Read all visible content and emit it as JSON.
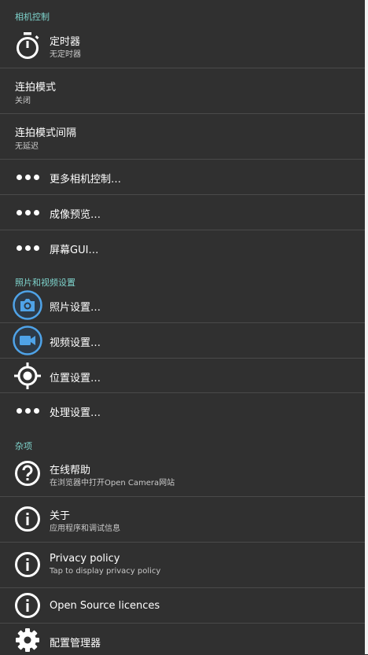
{
  "sections": {
    "camera_controls": "相机控制",
    "photo_video_settings": "照片和视频设置",
    "misc": "杂项"
  },
  "items": {
    "timer": {
      "title": "定时器",
      "summary": "无定时器"
    },
    "burst_mode": {
      "title": "连拍模式",
      "summary": "关闭"
    },
    "burst_interval": {
      "title": "连拍模式间隔",
      "summary": "无延迟"
    },
    "more_camera_controls": {
      "title": "更多相机控制…"
    },
    "preview": {
      "title": "成像预览…"
    },
    "on_screen_gui": {
      "title": "屏幕GUI…"
    },
    "photo_settings": {
      "title": "照片设置…"
    },
    "video_settings": {
      "title": "视频设置…"
    },
    "location_settings": {
      "title": "位置设置…"
    },
    "processing_settings": {
      "title": "处理设置…"
    },
    "online_help": {
      "title": "在线帮助",
      "summary": "在浏览器中打开Open Camera网站"
    },
    "about": {
      "title": "关于",
      "summary": "应用程序和调试信息"
    },
    "privacy_policy": {
      "title": "Privacy policy",
      "summary": "Tap to display privacy policy"
    },
    "open_source_licences": {
      "title": "Open Source licences"
    },
    "settings_manager": {
      "title": "配置管理器"
    }
  },
  "colors": {
    "background": "#303030",
    "category_accent": "#7ed3cc",
    "icon_blue": "#4fa3e8",
    "divider": "#4a4a4a"
  },
  "icons": {
    "timer": "stopwatch-icon",
    "more": "more-dots-icon",
    "photo": "camera-icon",
    "video": "videocam-icon",
    "location": "gps-crosshair-icon",
    "help": "help-circle-icon",
    "info": "info-circle-icon",
    "settings": "gear-icon"
  }
}
